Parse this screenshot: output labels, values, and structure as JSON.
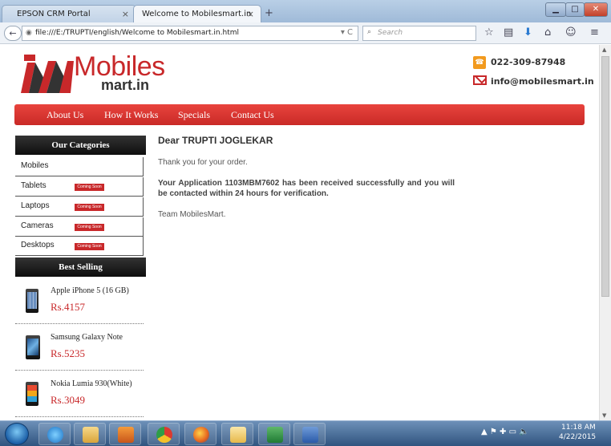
{
  "browser": {
    "tabs": [
      {
        "title": "EPSON CRM Portal",
        "close": "×"
      },
      {
        "title": "Welcome to Mobilesmart.in",
        "close": "×"
      }
    ],
    "new_tab": "+",
    "window_controls": {
      "minimize": "▁",
      "maximize": "□",
      "close": "✕"
    },
    "back": "←",
    "url": "file:///E:/TRUPTI/english/Welcome to Mobilesmart.in.html",
    "reload": "▾ C",
    "search_placeholder": "Search",
    "toolbar_icons": [
      "star-icon",
      "bookmarks-list-icon",
      "download-icon",
      "home-icon",
      "chat-icon",
      "menu-icon"
    ]
  },
  "site": {
    "logo_main": "Mobiles",
    "logo_sub": "mart.in",
    "phone": "022-309-87948",
    "email": "info@mobilesmart.in",
    "brand_color": "#c8282a",
    "menu": [
      "About Us",
      "How It Works",
      "Specials",
      "Contact Us"
    ]
  },
  "sidebar": {
    "categories_title": "Our Categories",
    "categories": [
      {
        "label": "Mobiles",
        "badge": ""
      },
      {
        "label": "Tablets",
        "badge": "Coming Soon"
      },
      {
        "label": "Laptops",
        "badge": "Coming Soon"
      },
      {
        "label": "Cameras",
        "badge": "Coming Soon"
      },
      {
        "label": "Desktops",
        "badge": "Coming Soon"
      }
    ],
    "best_selling_title": "Best Selling",
    "products": [
      {
        "name": "Apple iPhone 5 (16 GB)",
        "price": "Rs.4157"
      },
      {
        "name": "Samsung Galaxy Note",
        "price": "Rs.5235"
      },
      {
        "name": "Nokia Lumia 930(White)",
        "price": "Rs.3049"
      }
    ]
  },
  "content": {
    "greeting": "Dear TRUPTI JOGLEKAR",
    "thanks": "Thank you for your order.",
    "message": "Your Application 1103MBM7602 has been received successfully and you will be contacted within 24 hours for verification.",
    "signoff": "Team MobilesMart."
  },
  "taskbar": {
    "apps": [
      "internet-explorer-icon",
      "file-explorer-icon",
      "media-player-icon",
      "chrome-icon",
      "firefox-icon",
      "mail-icon",
      "excel-icon",
      "word-icon"
    ],
    "tray": "▲  ⚑  ✚  ▭  🔈",
    "time": "11:18 AM",
    "date": "4/22/2015"
  }
}
